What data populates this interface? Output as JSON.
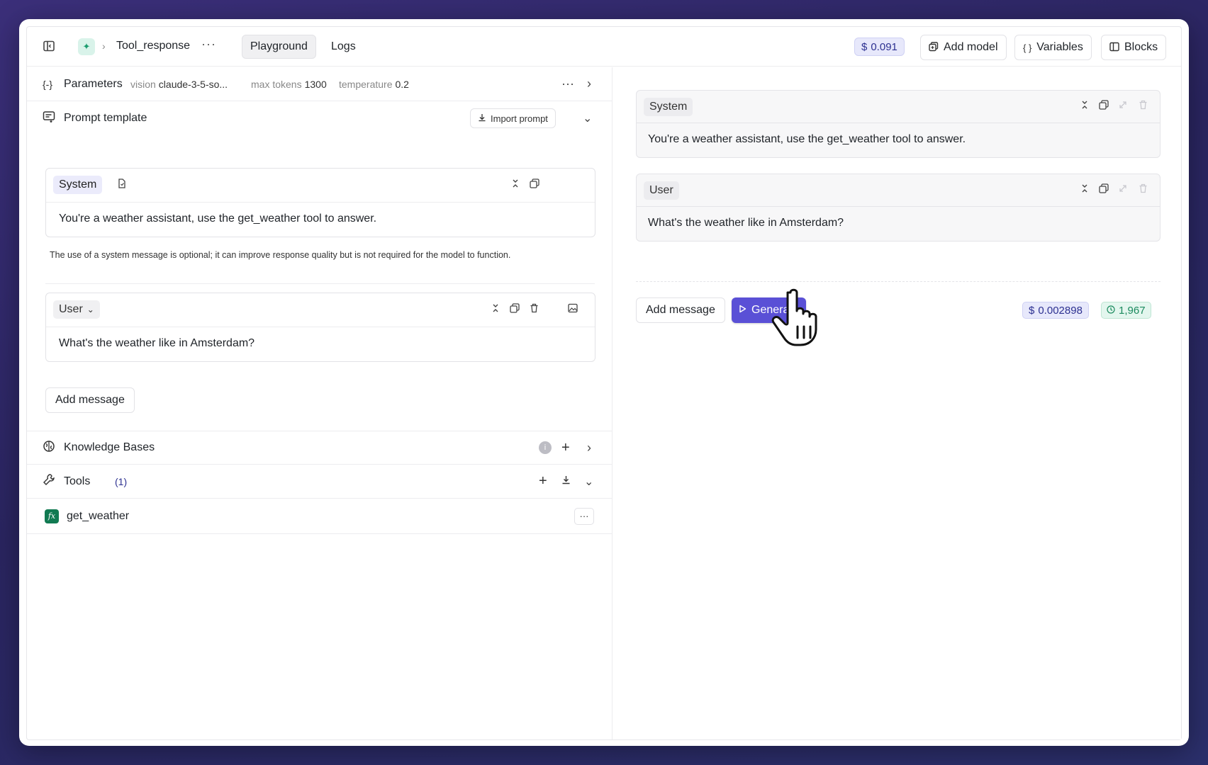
{
  "topbar": {
    "title": "Tool_response",
    "tabs": [
      {
        "label": "Playground"
      },
      {
        "label": "Logs"
      }
    ],
    "cost": "0.091",
    "add_model": "Add model",
    "variables": "Variables",
    "blocks": "Blocks"
  },
  "parameters": {
    "label": "Parameters",
    "vision_key": "vision",
    "vision_value": "claude-3-5-so...",
    "max_tokens_key": "max tokens",
    "max_tokens_value": "1300",
    "temperature_key": "temperature",
    "temperature_value": "0.2"
  },
  "prompt_template": {
    "label": "Prompt template",
    "import_label": "Import prompt",
    "system": {
      "role": "System",
      "content": "You're a weather assistant, use the get_weather tool to answer.",
      "note": "The use of a system message is optional; it can improve response quality but is not required for the model to function."
    },
    "user": {
      "role": "User",
      "content": "What's the weather like in Amsterdam?"
    },
    "add_message": "Add message"
  },
  "knowledge_bases": {
    "label": "Knowledge Bases"
  },
  "tools": {
    "label": "Tools",
    "count": "(1)",
    "items": [
      {
        "name": "get_weather"
      }
    ]
  },
  "output": {
    "system": {
      "role": "System",
      "content": "You're a weather assistant, use the get_weather tool to answer."
    },
    "user": {
      "role": "User",
      "content": "What's the weather like in Amsterdam?"
    },
    "add_message": "Add message",
    "generate": "Generate",
    "cost": "0.002898",
    "time": "1,967"
  },
  "colors": {
    "accent": "#5a50d6",
    "cost_bg": "#e7e8fb",
    "time_bg": "#e3f6ee",
    "tool_icon": "#117a52"
  },
  "icons": [
    "sidebar-toggle-icon",
    "app-sparkle-icon",
    "chevron-right-icon",
    "more-icon",
    "copy-icon",
    "braces-icon",
    "columns-icon",
    "prompt-icon",
    "download-icon",
    "chevron-down-icon",
    "collapse-icon",
    "trash-icon",
    "image-icon",
    "file-icon",
    "brain-icon",
    "info-icon",
    "plus-icon",
    "wrench-icon",
    "fx-icon",
    "expand-icon",
    "play-icon",
    "clock-icon",
    "pointer-cursor-icon"
  ]
}
